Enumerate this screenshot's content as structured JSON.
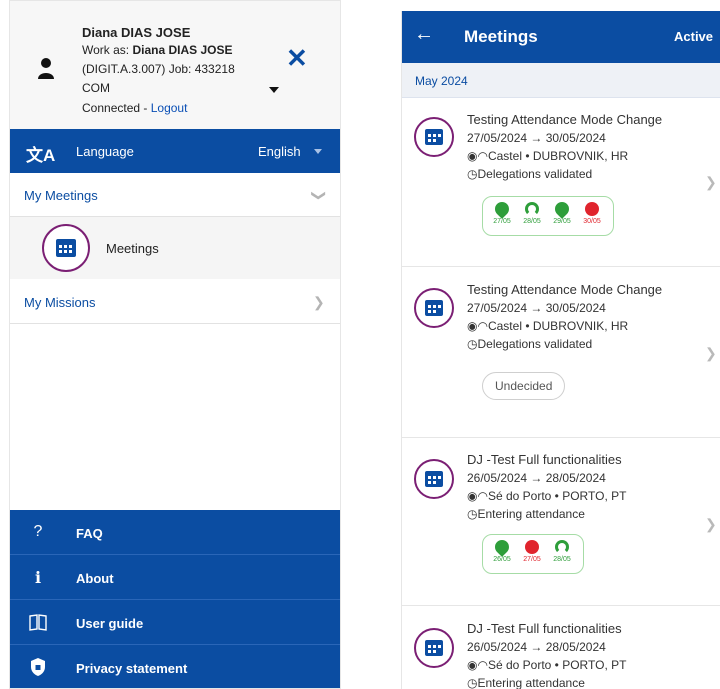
{
  "user": {
    "name": "Diana DIAS JOSE",
    "work_as_prefix": "Work as: ",
    "work_as_name": "Diana DIAS JOSE",
    "job_line": "(DIGIT.A.3.007) Job: 433218",
    "org": "COM",
    "connected": "Connected - ",
    "logout": "Logout"
  },
  "language": {
    "label": "Language",
    "value": "English"
  },
  "nav": {
    "my_meetings": "My Meetings",
    "meetings": "Meetings",
    "my_missions": "My Missions"
  },
  "footer": [
    {
      "label": "FAQ",
      "icon": "question-icon",
      "glyph": "?"
    },
    {
      "label": "About",
      "icon": "info-icon",
      "glyph": "i"
    },
    {
      "label": "User guide",
      "icon": "book-icon",
      "glyph": "📖"
    },
    {
      "label": "Privacy statement",
      "icon": "shield-icon",
      "glyph": "⛨"
    }
  ],
  "topbar": {
    "title": "Meetings",
    "filter": "Active"
  },
  "month": "May 2024",
  "cards": [
    {
      "title": "Testing Attendance Mode Change",
      "dates": "27/05/2024 → 30/05/2024",
      "place": "Castel • DUBROVNIK, HR",
      "status": "Delegations validated",
      "attendance": [
        {
          "type": "in-person",
          "date": "27/05",
          "color": "#2e9e3a"
        },
        {
          "type": "remote",
          "date": "28/05",
          "color": "#2e9e3a"
        },
        {
          "type": "in-person",
          "date": "29/05",
          "color": "#2e9e3a"
        },
        {
          "type": "absent",
          "date": "30/05",
          "color": "#e0242d"
        }
      ]
    },
    {
      "title": "Testing Attendance Mode Change",
      "dates": "27/05/2024 → 30/05/2024",
      "place": "Castel • DUBROVNIK, HR",
      "status": "Delegations validated",
      "badge": "Undecided"
    },
    {
      "title": "DJ -Test Full functionalities",
      "dates": "26/05/2024 → 28/05/2024",
      "place": "Sé do Porto • PORTO, PT",
      "status": "Entering attendance",
      "attendance": [
        {
          "type": "in-person",
          "date": "26/05",
          "color": "#2e9e3a"
        },
        {
          "type": "absent",
          "date": "27/05",
          "color": "#e0242d"
        },
        {
          "type": "remote",
          "date": "28/05",
          "color": "#2e9e3a"
        }
      ]
    },
    {
      "title": "DJ -Test Full functionalities",
      "dates": "26/05/2024 → 28/05/2024",
      "place": "Sé do Porto • PORTO, PT",
      "status": "Entering attendance"
    }
  ],
  "colors": {
    "primary": "#0b4da2",
    "meeting_ring": "#7b1f74",
    "present": "#2e9e3a",
    "absent": "#e0242d"
  }
}
